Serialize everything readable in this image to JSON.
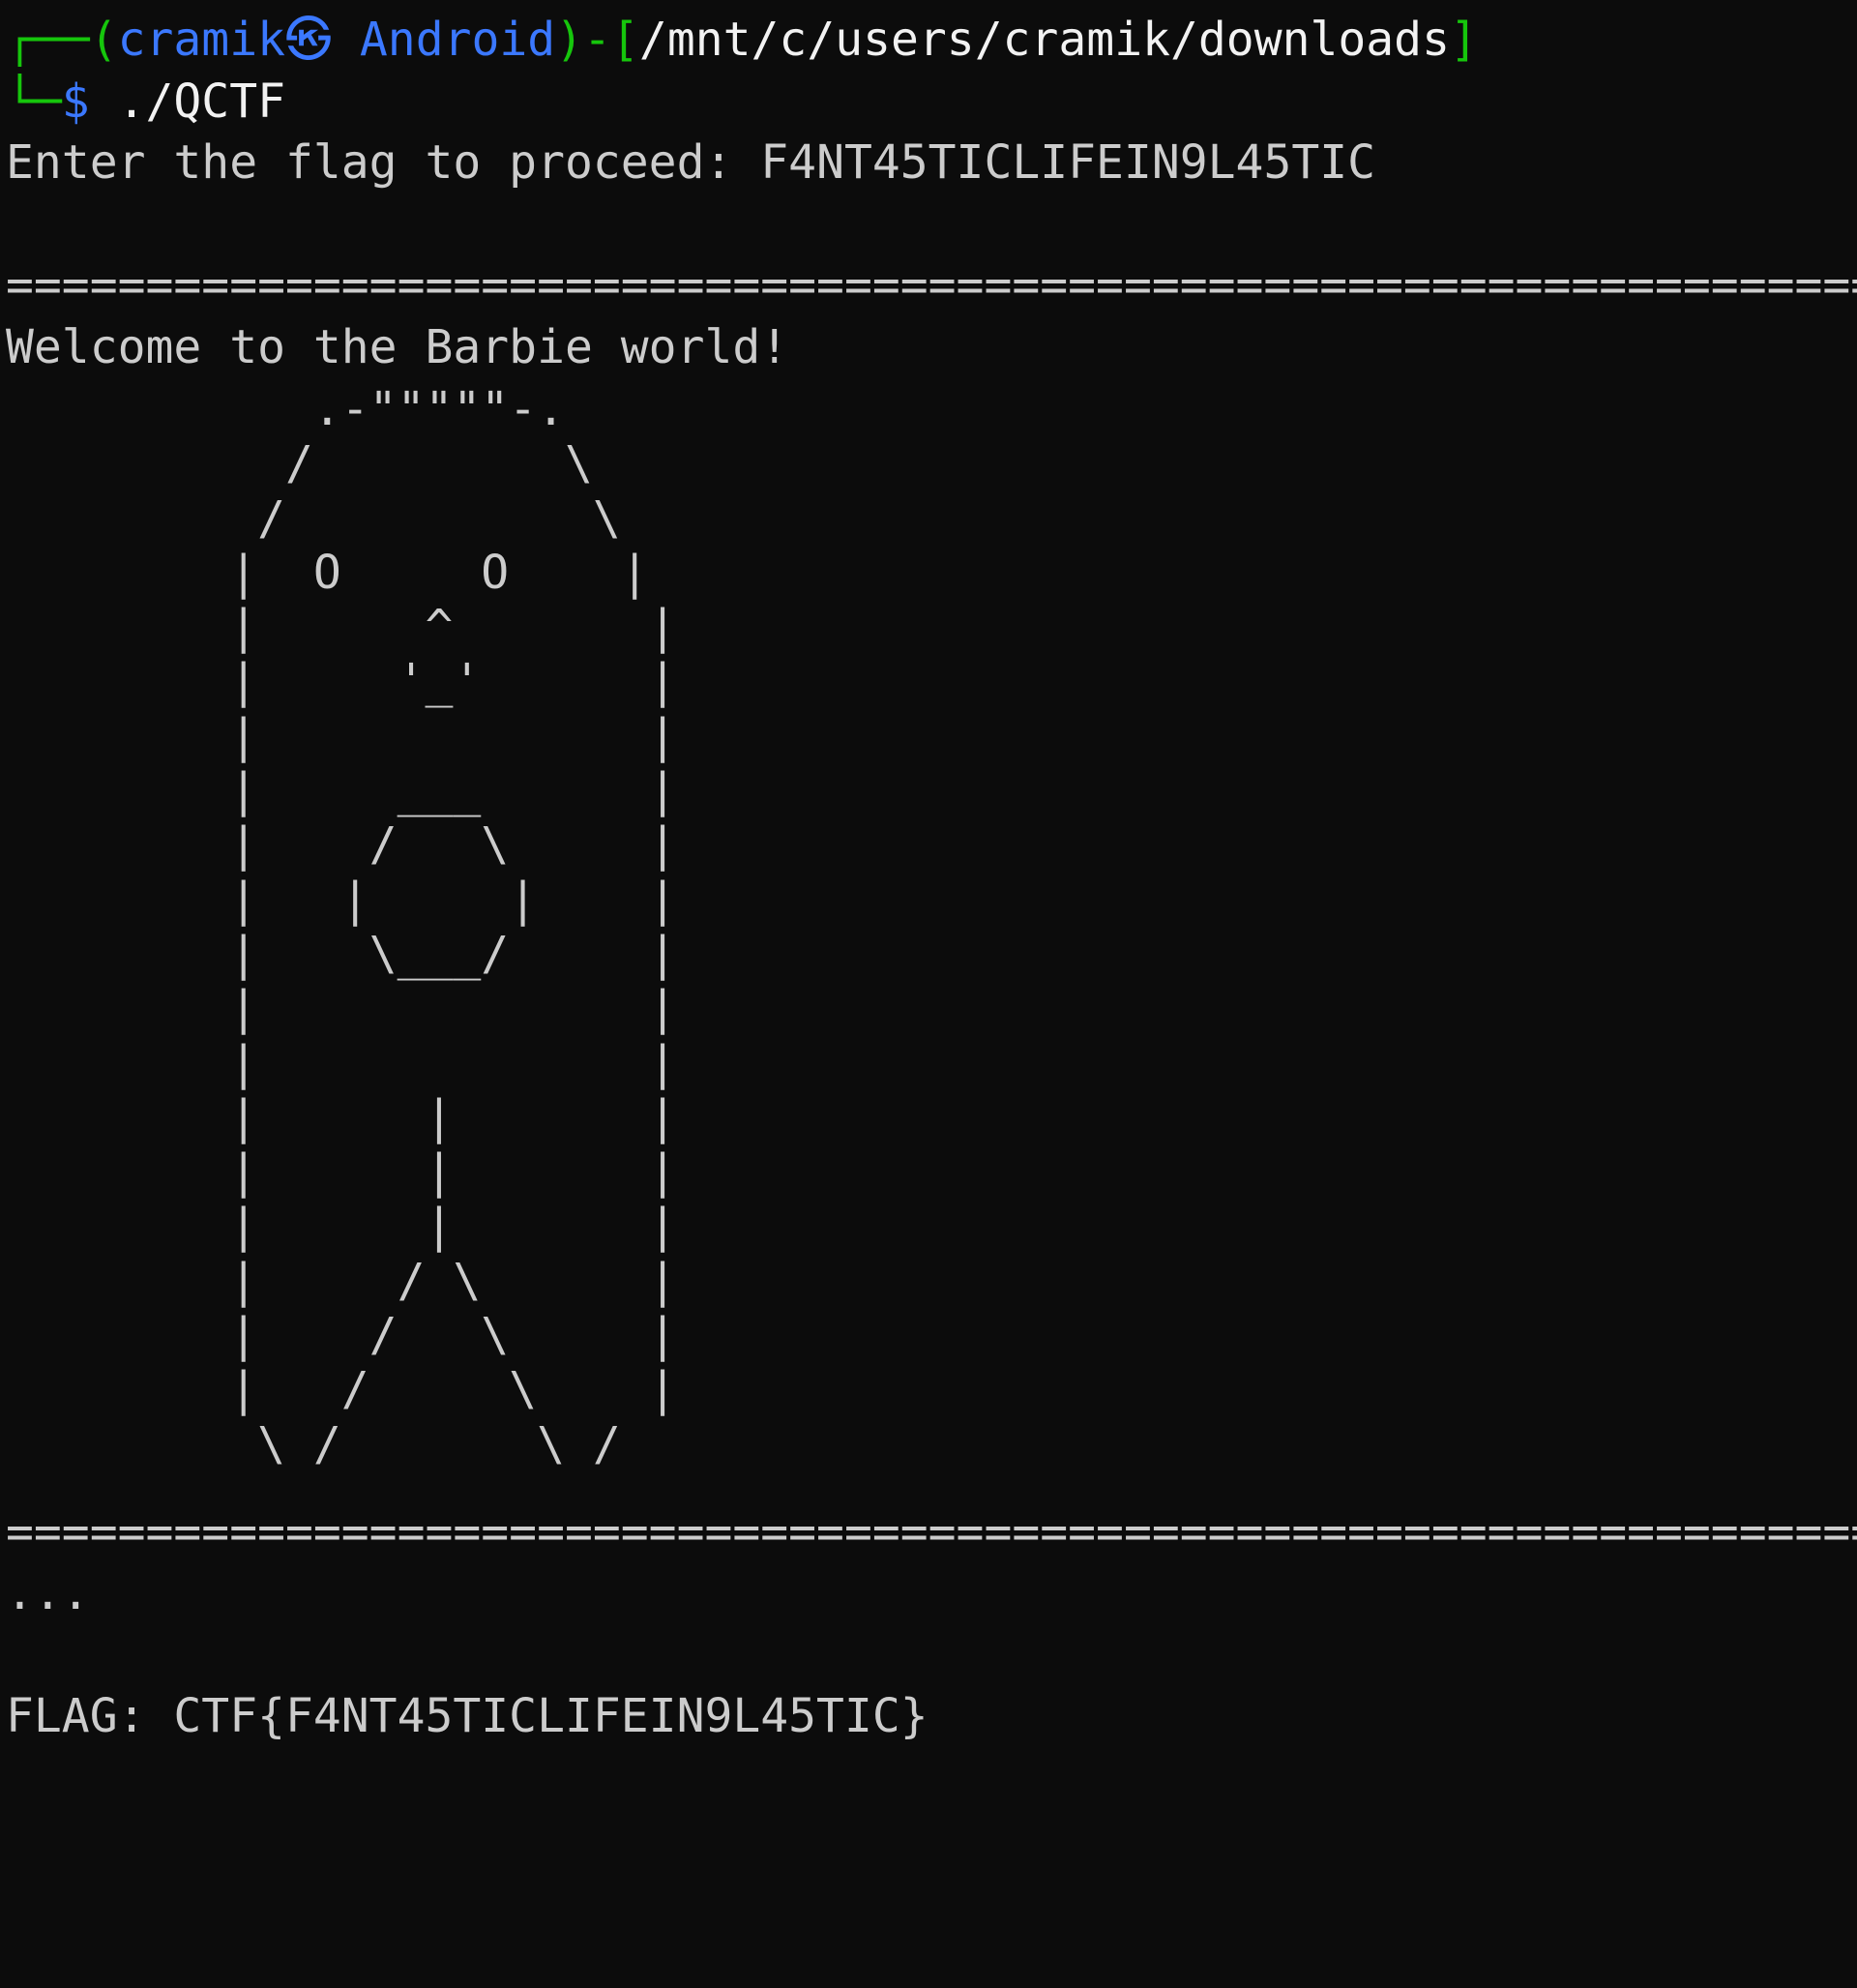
{
  "prompt": {
    "box_top": "┌──",
    "open_paren": "(",
    "user_host": "cramik㉿ Android",
    "close_paren": ")",
    "dash": "-",
    "open_bracket": "[",
    "path": "/mnt/c/users/cramik/downloads",
    "close_bracket": "]",
    "box_bottom": "└─",
    "dollar": "$",
    "command": "./QCTF"
  },
  "output": {
    "enter_flag_label": "Enter the flag to proceed: ",
    "entered_flag": "F4NT45TICLIFEIN9L45TIC",
    "separator_top": "=====================================================================",
    "welcome": "Welcome to the Barbie world!",
    "ascii_art": "           .-\"\"\"\"\"-.\n          /         \\\n         /           \\\n        |  O     O    |\n        |      ^       |\n        |     '_'      |\n        |              |\n        |     ___      |\n        |    /   \\     |\n        |   |     |    |\n        |    \\___/     |\n        |              |\n        |              |\n        |      |       |\n        |      |       |\n        |      |       |\n        |     / \\      |\n        |    /   \\     |\n        |   /     \\    |\n         \\ /       \\ /",
    "separator_bottom": "=====================================================================",
    "ellipsis": "...",
    "flag_line": "FLAG: CTF{F4NT45TICLIFEIN9L45TIC}"
  },
  "colors": {
    "background": "#0c0c0c",
    "text": "#cccccc",
    "prompt_green": "#16c60c",
    "prompt_blue": "#3b78ff"
  }
}
